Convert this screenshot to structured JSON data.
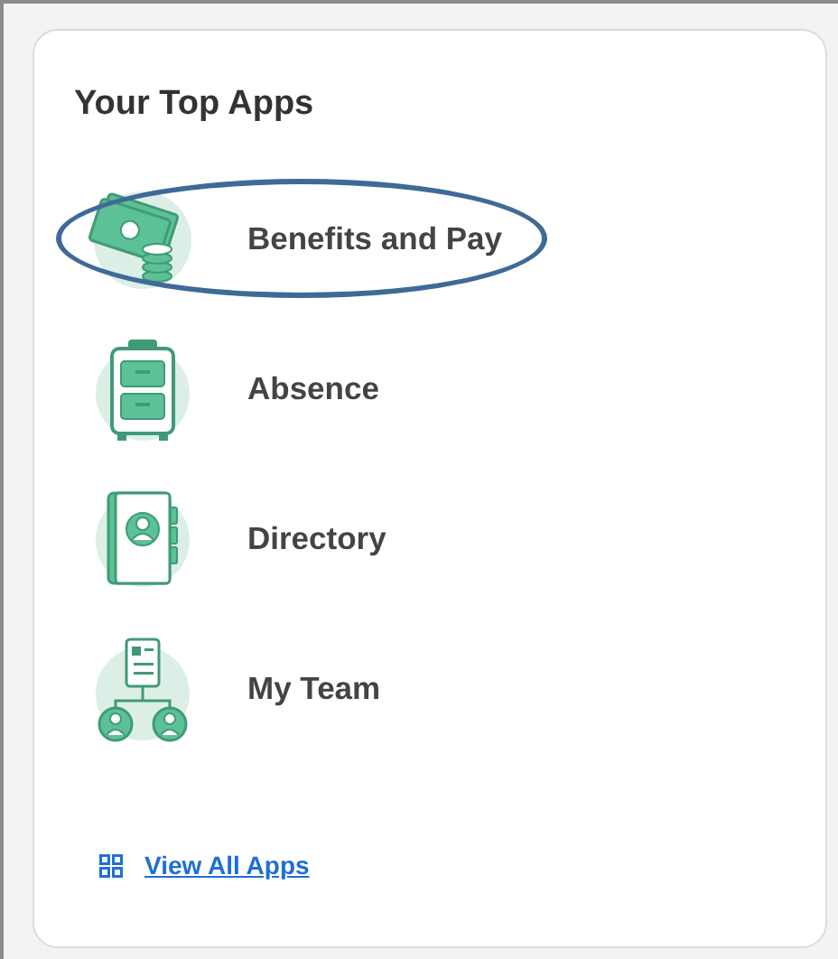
{
  "card": {
    "title": "Your Top Apps",
    "apps": [
      {
        "label": "Benefits and Pay",
        "highlighted": true
      },
      {
        "label": "Absence",
        "highlighted": false
      },
      {
        "label": "Directory",
        "highlighted": false
      },
      {
        "label": "My Team",
        "highlighted": false
      }
    ],
    "link": "View All Apps"
  }
}
